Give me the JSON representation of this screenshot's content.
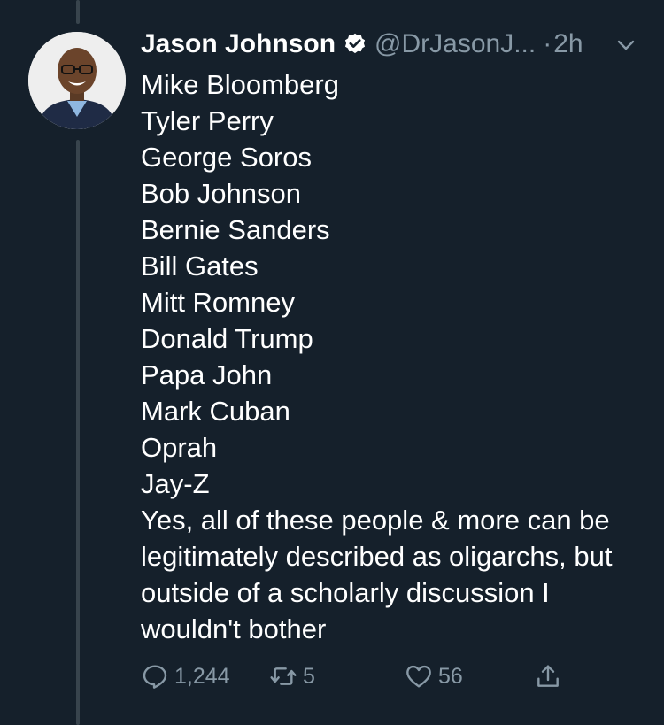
{
  "tweet": {
    "author_name": "Jason Johnson",
    "handle": "@DrJasonJ...",
    "separator": "·",
    "time": "2h",
    "lines": [
      "Mike Bloomberg",
      "Tyler Perry",
      "George Soros",
      "Bob Johnson",
      "Bernie Sanders",
      "Bill Gates",
      "Mitt Romney",
      "Donald Trump",
      "Papa John",
      "Mark Cuban",
      "Oprah",
      "Jay-Z"
    ],
    "closing": "Yes, all of these people & more can be legitimately described as oligarchs, but outside of a scholarly discussion I wouldn't bother"
  },
  "actions": {
    "replies": "1,244",
    "retweets": "5",
    "likes": "56"
  },
  "icons": {
    "verified": "verified-badge-icon",
    "menu": "chevron-down-icon",
    "reply": "reply-icon",
    "retweet": "retweet-icon",
    "like": "heart-icon",
    "share": "share-icon"
  },
  "colors": {
    "background": "#15202b",
    "secondary_text": "#8899a6",
    "thread_line": "#38444d"
  }
}
